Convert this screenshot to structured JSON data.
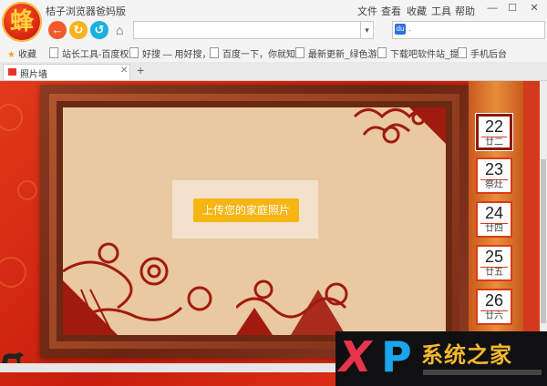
{
  "app": {
    "logo_text": "蜂",
    "title": "桔子浏览器爸妈版",
    "menus": [
      "文件",
      "查看",
      "收藏",
      "工具",
      "帮助"
    ],
    "window_controls": [
      "—",
      "☐",
      "✕"
    ]
  },
  "nav": {
    "back_icon": "←",
    "refresh_icon": "↻",
    "restore_icon": "↺",
    "home_icon": "⌂",
    "address_value": "",
    "dropdown_icon": "▾",
    "search_value": "."
  },
  "bookmarks": {
    "favorites_label": "收藏",
    "items": [
      "站长工具-百度权",
      "好搜 — 用好搜，",
      "百度一下，你就知",
      "最新更新_绿色游",
      "下载吧软件站_提",
      "手机后台"
    ]
  },
  "tabs": {
    "active_label": "照片墙",
    "close_icon": "✕",
    "new_tab_icon": "+"
  },
  "content": {
    "upload_button": "上传您的家庭照片",
    "calendar": [
      {
        "day": "22",
        "label": "廿二",
        "active": true
      },
      {
        "day": "23",
        "label": "祭灶",
        "active": false
      },
      {
        "day": "24",
        "label": "廿四",
        "active": false
      },
      {
        "day": "25",
        "label": "廿五",
        "active": false
      },
      {
        "day": "26",
        "label": "廿六",
        "active": false
      }
    ]
  },
  "watermark": {
    "letter_x": "X",
    "letter_p": "P",
    "text": "系统之家"
  },
  "colors": {
    "background_red": "#d52a12",
    "frame_brown": "#6b2914",
    "photo_beige": "#e9c9a1",
    "upload_yellow": "#f6b512",
    "paper_cut_red": "#a11a0e"
  }
}
